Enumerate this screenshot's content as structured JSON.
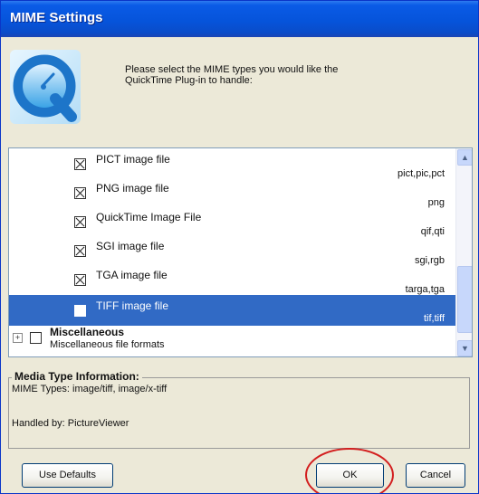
{
  "window": {
    "title": "MIME Settings"
  },
  "intro": {
    "text": "Please select the MIME types you would like the QuickTime Plug-in to handle:"
  },
  "list": {
    "items": [
      {
        "label": "PICT image file",
        "ext": "pict,pic,pct",
        "checked": true,
        "selected": false
      },
      {
        "label": "PNG image file",
        "ext": "png",
        "checked": true,
        "selected": false
      },
      {
        "label": "QuickTime Image File",
        "ext": "qif,qti",
        "checked": true,
        "selected": false
      },
      {
        "label": "SGI image file",
        "ext": "sgi,rgb",
        "checked": true,
        "selected": false
      },
      {
        "label": "TGA image file",
        "ext": "targa,tga",
        "checked": true,
        "selected": false
      },
      {
        "label": "TIFF image file",
        "ext": "tif,tiff",
        "checked": false,
        "selected": true
      }
    ],
    "category": {
      "label": "Miscellaneous",
      "description": "Miscellaneous file formats",
      "expander": "+"
    },
    "scroll_up": "▲",
    "scroll_down": "▼"
  },
  "info": {
    "title": "Media Type Information:",
    "mime_line": "MIME Types: image/tiff, image/x-tiff",
    "handled_line": "Handled by:  PictureViewer"
  },
  "buttons": {
    "use_defaults": "Use Defaults",
    "ok": "OK",
    "cancel": "Cancel"
  },
  "colors": {
    "titlebar": "#0654db",
    "selection": "#316ac5",
    "annotation": "#d31f1f"
  }
}
